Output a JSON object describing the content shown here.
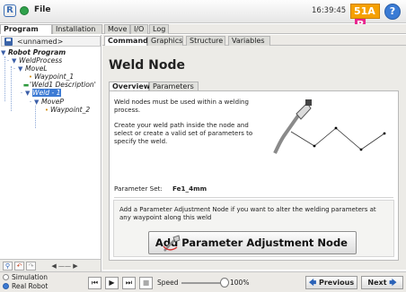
{
  "titlebar": {
    "logo_glyph": "R",
    "menu_file": "File",
    "time": "16:39:45",
    "badge_main": "51A",
    "badge_b": "B",
    "help_glyph": "?",
    "accent_color": "#f5a000"
  },
  "main_tabs": [
    "Program",
    "Installation",
    "Move",
    "I/O",
    "Log"
  ],
  "program_tree": {
    "program_name": "<unnamed>",
    "items": [
      {
        "label": "Robot Program",
        "icon": "collapse-triangle"
      },
      {
        "label": "WeldProcess",
        "icon": "collapse-triangle"
      },
      {
        "label": "MoveL",
        "icon": "collapse-triangle"
      },
      {
        "label": "Waypoint_1",
        "icon": "waypoint-icon"
      },
      {
        "label": "'Weld1 Description'",
        "icon": "comment-icon"
      },
      {
        "label": "Weld - 1",
        "icon": "collapse-triangle"
      },
      {
        "label": "MoveP",
        "icon": "collapse-triangle"
      },
      {
        "label": "Waypoint_2",
        "icon": "waypoint-icon"
      }
    ]
  },
  "command_tabs": [
    "Command",
    "Graphics",
    "Structure",
    "Variables"
  ],
  "node": {
    "title": "Weld Node",
    "sub_tabs": [
      "Overview",
      "Parameters"
    ],
    "intro_1": "Weld nodes must be used within a welding process.",
    "intro_2": "Create your weld path inside the node and select or create a valid set of parameters to specify the weld.",
    "param_label": "Parameter Set:",
    "param_value": "Fe1_4mm",
    "adjust_help": "Add a Parameter Adjustment Node if you want to alter the welding parameters at any waypoint along this weld",
    "adjust_button": "Add Parameter Adjustment Node"
  },
  "bottom": {
    "mode_simulation": "Simulation",
    "mode_real": "Real Robot",
    "selected_mode": "Real Robot",
    "speed_label": "Speed",
    "speed_value": "100%",
    "speed_fraction": 1.0,
    "previous": "Previous",
    "next": "Next"
  }
}
